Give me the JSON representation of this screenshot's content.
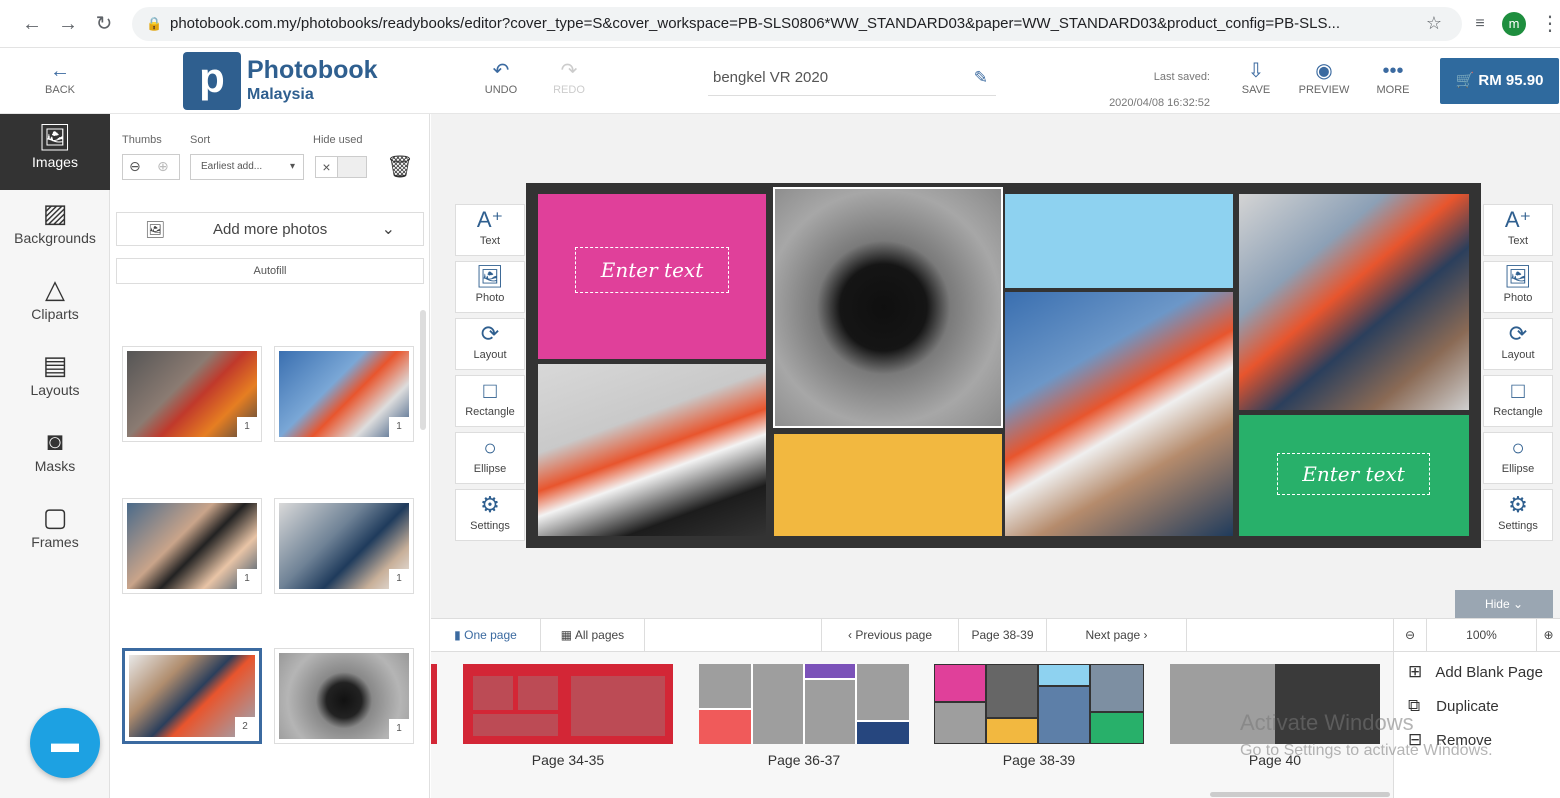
{
  "browser": {
    "url": "photobook.com.my/photobooks/readybooks/editor?cover_type=S&cover_workspace=PB-SLS0806*WW_STANDARD03&paper=WW_STANDARD03&product_config=PB-SLS...",
    "profile_initial": "m"
  },
  "header": {
    "back_label": "BACK",
    "logo_name": "Photobook",
    "logo_sub": "Malaysia",
    "undo_label": "UNDO",
    "redo_label": "REDO",
    "project_name": "bengkel VR 2020",
    "last_saved_label": "Last saved:",
    "last_saved_time": "2020/04/08 16:32:52",
    "save_label": "SAVE",
    "preview_label": "PREVIEW",
    "more_label": "MORE",
    "cart_label": "RM 95.90"
  },
  "leftnav": {
    "items": [
      {
        "label": "Images",
        "active": true
      },
      {
        "label": "Backgrounds"
      },
      {
        "label": "Cliparts"
      },
      {
        "label": "Layouts"
      },
      {
        "label": "Masks"
      },
      {
        "label": "Frames"
      }
    ]
  },
  "panel": {
    "thumbs_label": "Thumbs",
    "sort_label": "Sort",
    "hide_used_label": "Hide used",
    "sort_value": "Earliest add...",
    "add_more_label": "Add more photos",
    "autofill_label": "Autofill",
    "photos": [
      {
        "count": "1",
        "color": "#7a6f66"
      },
      {
        "count": "1",
        "color": "#5d7fa8"
      },
      {
        "count": "1",
        "color": "#7d6a5e"
      },
      {
        "count": "1",
        "color": "#556b7f"
      },
      {
        "count": "2",
        "color": "#8a7f74"
      },
      {
        "count": "1",
        "color": "#777777"
      }
    ]
  },
  "tools": {
    "text": "Text",
    "photo": "Photo",
    "layout": "Layout",
    "rectangle": "Rectangle",
    "ellipse": "Ellipse",
    "settings": "Settings"
  },
  "canvas": {
    "enter_text_1": "Enter text",
    "enter_text_2": "Enter text",
    "colors": {
      "pink": "#e0409a",
      "sky": "#8ed2f0",
      "yellow": "#f2b840",
      "green": "#28b06a"
    }
  },
  "bottombar": {
    "one_page": "One page",
    "all_pages": "All pages",
    "previous_page": "Previous page",
    "page_indicator": "Page 38-39",
    "next_page": "Next page",
    "zoom": "100%",
    "hide_label": "Hide"
  },
  "strip": {
    "pages": [
      "Page 34-35",
      "Page 36-37",
      "Page 38-39",
      "Page 40"
    ]
  },
  "context_menu": {
    "add_blank": "Add Blank Page",
    "duplicate": "Duplicate",
    "remove": "Remove"
  },
  "watermark": {
    "line1": "Activate Windows",
    "line2": "Go to Settings to activate Windows."
  }
}
